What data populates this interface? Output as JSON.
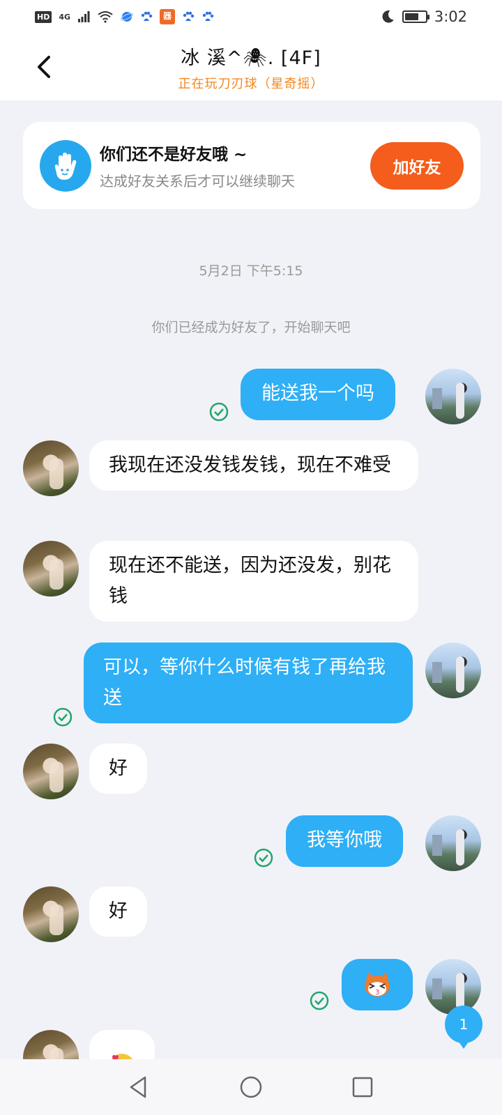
{
  "status_bar": {
    "hd": "HD",
    "network": "4G",
    "app_icon_label": "器",
    "time": "3:02",
    "icons": [
      "signal-icon",
      "wifi-icon",
      "browser-icon",
      "baidu-icon",
      "app-icon",
      "moon-icon",
      "battery-icon"
    ]
  },
  "header": {
    "title": "冰 溪^🕷. [4F]",
    "subtitle": "正在玩刀刃球（星奇摇）"
  },
  "friend_card": {
    "title": "你们还不是好友哦 ~",
    "subtitle": "达成好友关系后才可以继续聊天",
    "button_label": "加好友"
  },
  "chat": {
    "date": "5月2日 下午5:15",
    "system_message": "你们已经成为好友了，开始聊天吧",
    "messages": [
      {
        "from": "me",
        "text": "能送我一个吗"
      },
      {
        "from": "other",
        "text": "我现在还没发钱发钱，现在不难受"
      },
      {
        "from": "other",
        "text": "现在还不能送，因为还没发，别花钱"
      },
      {
        "from": "me",
        "text": "可以，等你什么时候有钱了再给我送"
      },
      {
        "from": "other",
        "text": "好"
      },
      {
        "from": "me",
        "text": "我等你哦"
      },
      {
        "from": "other",
        "text": "好"
      },
      {
        "from": "me",
        "text": "",
        "sticker": "raccoon-sticker"
      },
      {
        "from": "other",
        "text": "",
        "sticker": "smiling-face-with-hearts-emoji"
      }
    ],
    "unread_badge": "1"
  },
  "colors": {
    "accent": "#2eaff6",
    "add_friend": "#f45d1b",
    "subtitle_orange": "#f3861f",
    "read_check": "#21a56a"
  }
}
